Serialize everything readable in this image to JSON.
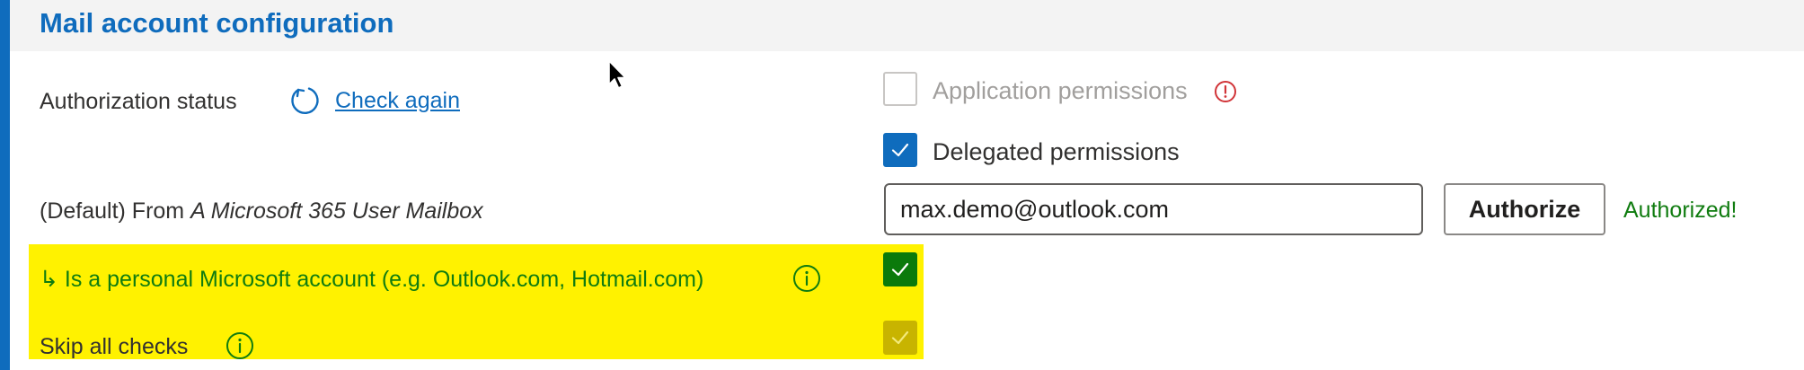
{
  "header": {
    "title": "Mail account configuration"
  },
  "authorization": {
    "label": "Authorization status",
    "check_again_link": "Check again"
  },
  "permissions": {
    "application_label": "Application permissions",
    "delegated_label": "Delegated permissions"
  },
  "default_from": {
    "prefix": "(Default) From ",
    "mailbox_type": "A Microsoft 365 User Mailbox"
  },
  "email_field": {
    "value": "max.demo@outlook.com"
  },
  "authorize_button": {
    "label": "Authorize"
  },
  "auth_result": {
    "text": "Authorized!"
  },
  "personal_account": {
    "arrow": "↳",
    "label": "Is a personal Microsoft account (e.g. Outlook.com, Hotmail.com)"
  },
  "skip_checks": {
    "label": "Skip all checks"
  },
  "colors": {
    "accent": "#0f6cbd",
    "success": "#107c10",
    "error": "#d13438",
    "highlight": "#fff200"
  }
}
